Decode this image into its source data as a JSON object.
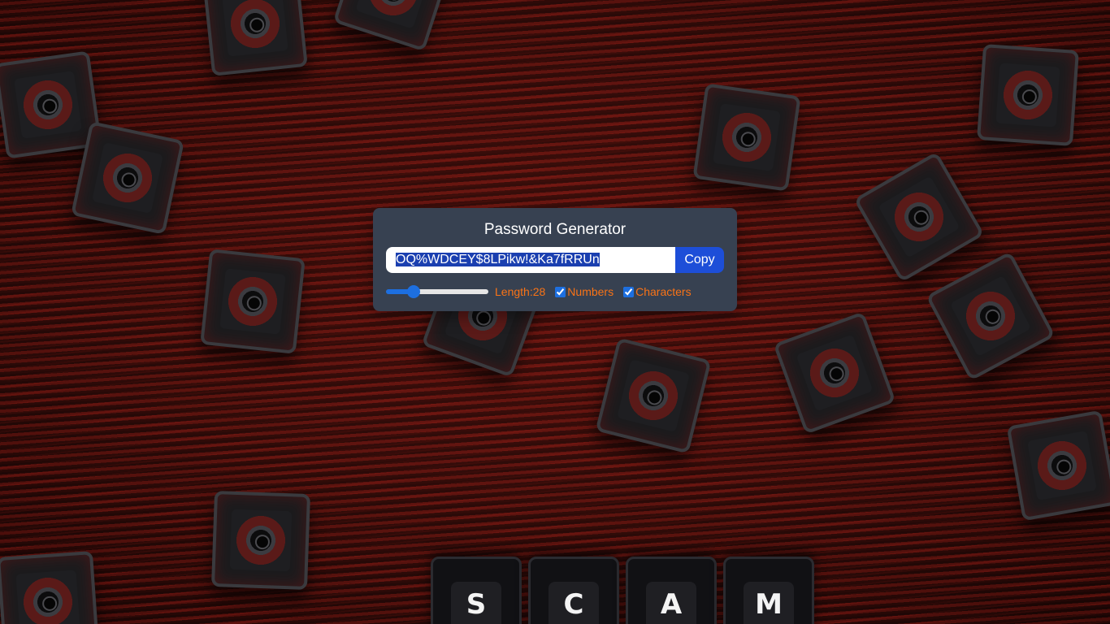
{
  "app": {
    "title": "Password Generator"
  },
  "password": {
    "value": "OQ%WDCEY$8LPikw!&Ka7fRRUn",
    "selected": true
  },
  "copy_button": {
    "label": "Copy"
  },
  "length_control": {
    "label": "Length:",
    "value": "28",
    "fill_fraction": 0.26
  },
  "options": {
    "numbers": {
      "label": "Numbers",
      "checked": true
    },
    "characters": {
      "label": "Characters",
      "checked": true
    }
  },
  "background_keycaps": {
    "letters": [
      "S",
      "C",
      "A",
      "M"
    ]
  },
  "colors": {
    "panel_bg": "#374151",
    "accent_blue": "#1d4ed8",
    "label_orange": "#f97316",
    "title_text": "#ffffff"
  }
}
